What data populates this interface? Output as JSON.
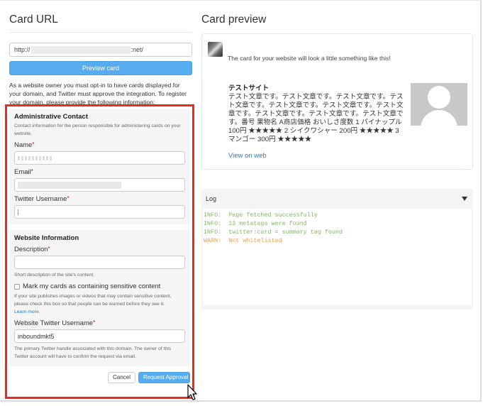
{
  "left": {
    "title": "Card URL",
    "url": {
      "prefix": "http://",
      "suffix": ":net/"
    },
    "preview_button": "Preview card",
    "intro": "As a website owner you must opt-in to have cards displayed for your domain, and Twitter must approve the integration. To register your domain, please provide the following information:",
    "admin": {
      "title": "Administrative Contact",
      "description": "Contact information for the person responsible for administering cards on your website.",
      "name_label": "Name",
      "email_label": "Email",
      "twitter_label": "Twitter Username",
      "required_mark": "*"
    },
    "website": {
      "title": "Website Information",
      "description_label": "Description",
      "description_help": "Short description of the site's content.",
      "sensitive_label": "Mark my cards as containing sensitive content",
      "sensitive_checked": false,
      "sensitive_help": "If your site publishes images or videos that may contain sensitive content, please check this box so that people can be warned before they see it.",
      "learn_more": "Learn more.",
      "site_twitter_label": "Website Twitter Username",
      "site_twitter_value": "inboundmkt5",
      "site_twitter_help": "The primary Twitter handle associated with this domain. The owner of this Twitter account will have to confirm the request via email."
    },
    "cancel_button": "Cancel",
    "request_button": "Request Approval"
  },
  "right": {
    "title": "Card preview",
    "card": {
      "message": "The card for your website will look a little something like this!",
      "site_title": "テストサイト",
      "body": "テスト文章です。テスト文章です。テスト文章です。テスト文章です。テスト文章です。テスト文章です。テスト文章です。テスト文章です。テスト文章です。テスト文章です。番号 果物名 A商店価格 おいしさ度数 1 パイナップル 100円 ★★★★★ 2 シイクワシャー 200円 ★★★★★ 3 マンゴー 300円 ★★★★★",
      "view_link": "View on web"
    },
    "log": {
      "title": "Log",
      "lines": [
        {
          "level": "INFO:",
          "message": "Page fetched successfully",
          "type": "info"
        },
        {
          "level": "INFO:",
          "message": "13 metatags were found",
          "type": "info"
        },
        {
          "level": "INFO:",
          "message": "twitter:card = summary tag found",
          "type": "info"
        },
        {
          "level": "WARN:",
          "message": "Not whitelisted",
          "type": "warn"
        }
      ]
    }
  },
  "colors": {
    "accent": "#55acee",
    "highlight_box": "#ee2b18",
    "link": "#2b7bb9",
    "log_info": "#80b962",
    "log_warn": "#f0a050"
  }
}
